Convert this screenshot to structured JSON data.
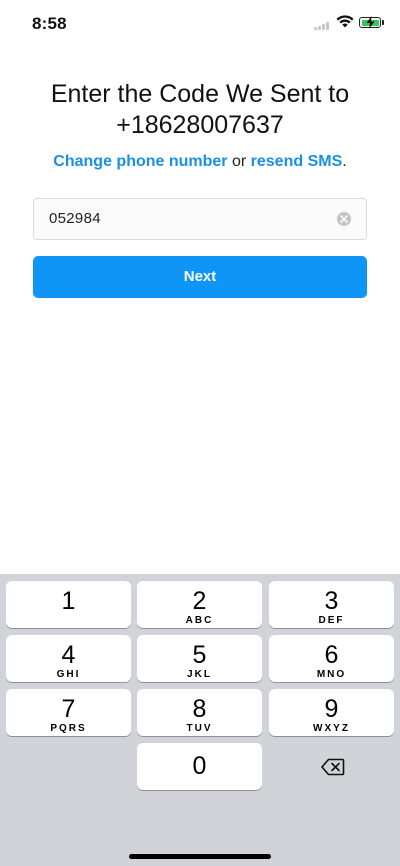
{
  "status_bar": {
    "time": "8:58"
  },
  "header": {
    "title_line1": "Enter the Code We Sent to",
    "title_line2": "+18628007637"
  },
  "subtitle": {
    "change_link": "Change phone number",
    "connector": " or ",
    "resend_link": "resend SMS",
    "end": "."
  },
  "code_field": {
    "value": "052984",
    "clear_icon": "clear-circle-icon"
  },
  "next_button": {
    "label": "Next",
    "color": "#0f95f6"
  },
  "keypad": {
    "keys": [
      {
        "digit": "1",
        "letters": ""
      },
      {
        "digit": "2",
        "letters": "ABC"
      },
      {
        "digit": "3",
        "letters": "DEF"
      },
      {
        "digit": "4",
        "letters": "GHI"
      },
      {
        "digit": "5",
        "letters": "JKL"
      },
      {
        "digit": "6",
        "letters": "MNO"
      },
      {
        "digit": "7",
        "letters": "PQRS"
      },
      {
        "digit": "8",
        "letters": "TUV"
      },
      {
        "digit": "9",
        "letters": "WXYZ"
      },
      {
        "digit": "0",
        "letters": ""
      }
    ],
    "backspace_icon": "backspace-icon"
  }
}
